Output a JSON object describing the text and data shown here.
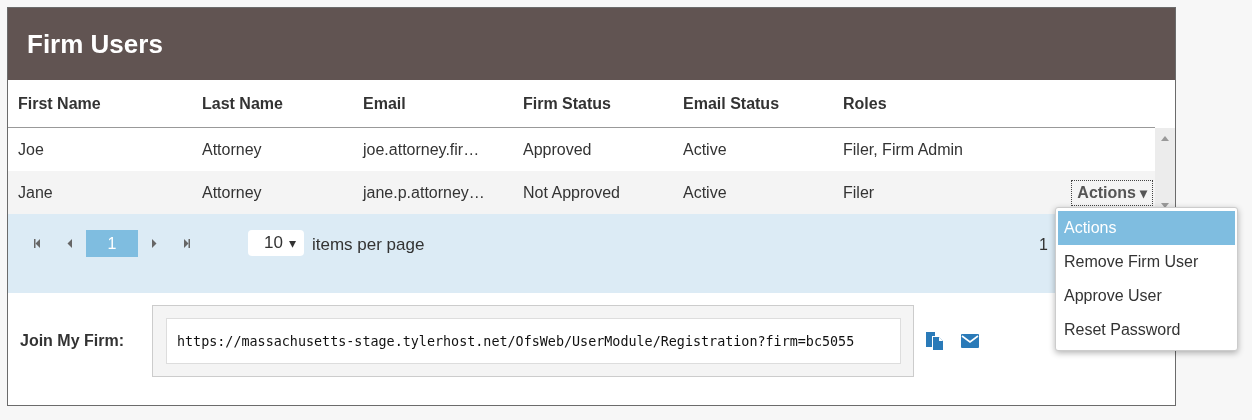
{
  "title": "Firm Users",
  "table": {
    "columns": [
      "First Name",
      "Last Name",
      "Email",
      "Firm Status",
      "Email Status",
      "Roles"
    ],
    "rows": [
      {
        "cells": [
          "Joe",
          "Attorney",
          "joe.attorney.fir…",
          "Approved",
          "Active",
          "Filer, Firm Admin"
        ],
        "actions_button": null
      },
      {
        "cells": [
          "Jane",
          "Attorney",
          "jane.p.attorney…",
          "Not Approved",
          "Active",
          "Filer"
        ],
        "actions_button": {
          "label": "Actions",
          "caret": "▾",
          "focused": true
        }
      }
    ]
  },
  "actions_menu": [
    {
      "label": "Actions",
      "selected": true
    },
    {
      "label": "Remove Firm User",
      "selected": false
    },
    {
      "label": "Approve User",
      "selected": false
    },
    {
      "label": "Reset Password",
      "selected": false
    }
  ],
  "pager": {
    "current_page": "1",
    "page_size": "10",
    "page_size_caret": "▾",
    "page_size_label": "items per page",
    "summary": "1"
  },
  "join": {
    "label": "Join My Firm:",
    "url": "https://massachusetts-stage.tylerhost.net/OfsWeb/UserModule/Registration?firm=bc5055"
  }
}
